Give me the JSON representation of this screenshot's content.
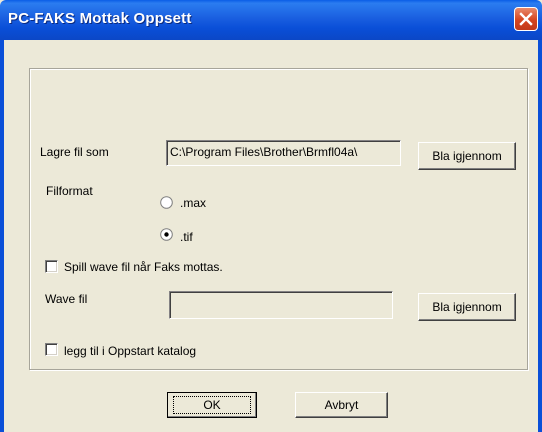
{
  "window": {
    "title": "PC-FAKS Mottak Oppsett"
  },
  "form": {
    "save_as_label": "Lagre fil som",
    "save_as_value": "C:\\Program Files\\Brother\\Brmfl04a\\",
    "browse1_label": "Bla igjennom",
    "file_format_label": "Filformat",
    "format_options": [
      {
        "label": ".max",
        "selected": false
      },
      {
        "label": ".tif",
        "selected": true
      }
    ],
    "play_wave_label": "Spill wave fil når Faks mottas.",
    "play_wave_checked": false,
    "wave_file_label": "Wave fil",
    "wave_file_value": "",
    "browse2_label": "Bla igjennom",
    "startup_label": "legg til i Oppstart katalog",
    "startup_checked": false
  },
  "buttons": {
    "ok_label": "OK",
    "cancel_label": "Avbryt"
  },
  "colors": {
    "titlebar": "#0a4fd8",
    "dialog_bg": "#ece9d8",
    "close_button": "#d6451f"
  }
}
